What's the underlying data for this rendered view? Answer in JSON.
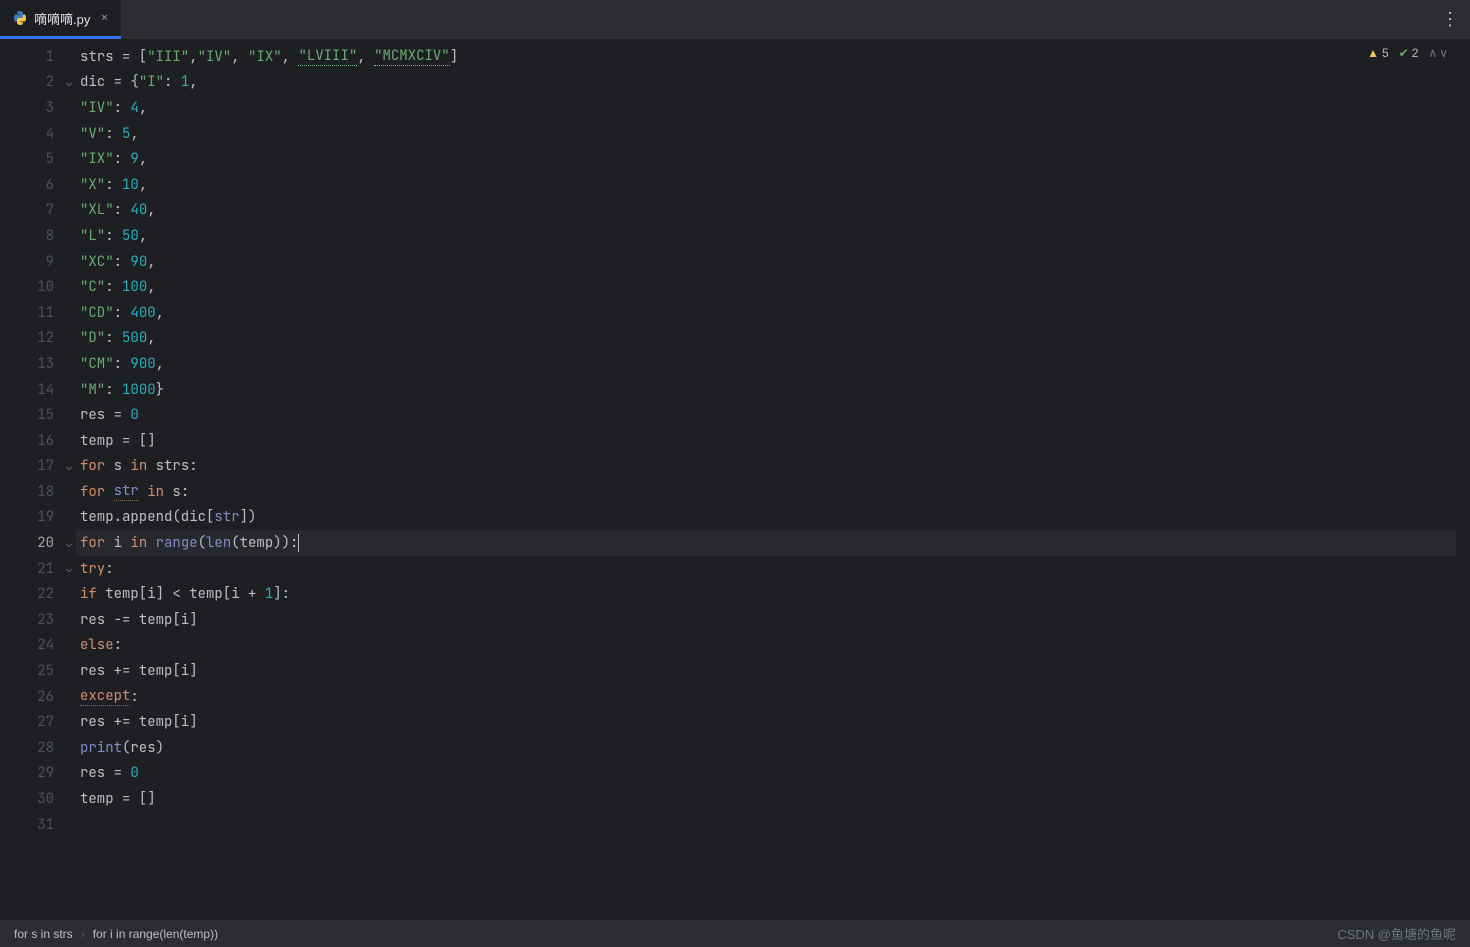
{
  "tab": {
    "filename": "嘀嘀嘀.py"
  },
  "inspections": {
    "warnings": "5",
    "typos": "2"
  },
  "breadcrumbs": [
    "for s in strs",
    "for i in range(len(temp))"
  ],
  "watermark": "CSDN @鱼塘的鱼呢",
  "gutter": {
    "lines": 31,
    "current": 20,
    "folds": [
      2,
      17,
      20,
      21
    ]
  },
  "code": {
    "l1": {
      "a": "strs = [",
      "s1": "\"III\"",
      "c1": ",",
      "s2": "\"IV\"",
      "c2": ", ",
      "s3": "\"IX\"",
      "c3": ", ",
      "s4": "\"LVIII\"",
      "c4": ", ",
      "s5": "\"MCMXCIV\"",
      "b": "]"
    },
    "l2": {
      "a": "dic = {",
      "k": "\"I\"",
      "c": ": ",
      "v": "1",
      "e": ","
    },
    "l3": {
      "k": "\"IV\"",
      "c": ": ",
      "v": "4",
      "e": ","
    },
    "l4": {
      "k": "\"V\"",
      "c": ": ",
      "v": "5",
      "e": ","
    },
    "l5": {
      "k": "\"IX\"",
      "c": ": ",
      "v": "9",
      "e": ","
    },
    "l6": {
      "k": "\"X\"",
      "c": ": ",
      "v": "10",
      "e": ","
    },
    "l7": {
      "k": "\"XL\"",
      "c": ": ",
      "v": "40",
      "e": ","
    },
    "l8": {
      "k": "\"L\"",
      "c": ": ",
      "v": "50",
      "e": ","
    },
    "l9": {
      "k": "\"XC\"",
      "c": ": ",
      "v": "90",
      "e": ","
    },
    "l10": {
      "k": "\"C\"",
      "c": ": ",
      "v": "100",
      "e": ","
    },
    "l11": {
      "k": "\"CD\"",
      "c": ": ",
      "v": "400",
      "e": ","
    },
    "l12": {
      "k": "\"D\"",
      "c": ": ",
      "v": "500",
      "e": ","
    },
    "l13": {
      "k": "\"CM\"",
      "c": ": ",
      "v": "900",
      "e": ","
    },
    "l14": {
      "k": "\"M\"",
      "c": ": ",
      "v": "1000",
      "e": "}"
    },
    "l15": {
      "a": "res = ",
      "v": "0"
    },
    "l16": {
      "a": "temp = []"
    },
    "l17": {
      "kw1": "for ",
      "a": "s ",
      "kw2": "in ",
      "b": "strs:"
    },
    "l18": {
      "kw1": "for ",
      "a": "str",
      "kw2": " in ",
      "b": "s:"
    },
    "l19": {
      "a": "temp.append(dic[",
      "b": "str",
      "c": "])"
    },
    "l20": {
      "kw1": "for ",
      "a": "i ",
      "kw2": "in ",
      "fn": "range",
      "p1": "(",
      "bi": "len",
      "p2": "(temp)):"
    },
    "l21": {
      "kw": "try",
      "c": ":"
    },
    "l22": {
      "kw": "if ",
      "a": "temp[i] < temp[i + ",
      "n": "1",
      "b": "]:"
    },
    "l23": {
      "a": "res -= temp[i]"
    },
    "l24": {
      "kw": "else",
      "c": ":"
    },
    "l25": {
      "a": "res += temp[i]"
    },
    "l26": {
      "kw": "except",
      "c": ":"
    },
    "l27": {
      "a": "res += temp[i]"
    },
    "l28": {
      "fn": "print",
      "a": "(res)"
    },
    "l29": {
      "a": "res = ",
      "v": "0"
    },
    "l30": {
      "a": "temp = []"
    }
  }
}
